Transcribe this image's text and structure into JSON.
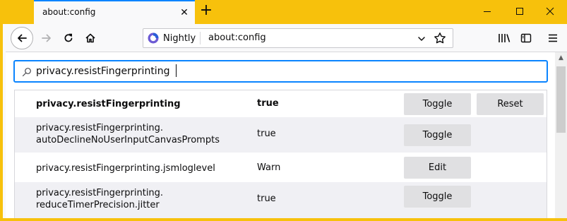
{
  "window": {
    "tab_title": "about:config",
    "tab_close": "✕",
    "new_tab": "+"
  },
  "toolbar": {
    "identity_label": "Nightly",
    "url": "about:config"
  },
  "search": {
    "value": "privacy.resistFingerprinting"
  },
  "prefs": [
    {
      "name_line1": "privacy.resistFingerprinting",
      "name_line2": "",
      "value": "true",
      "modified": true,
      "action": "Toggle",
      "reset": "Reset"
    },
    {
      "name_line1": "privacy.resistFingerprinting.",
      "name_line2": "autoDeclineNoUserInputCanvasPrompts",
      "value": "true",
      "modified": false,
      "action": "Toggle"
    },
    {
      "name_line1": "privacy.resistFingerprinting.jsmloglevel",
      "name_line2": "",
      "value": "Warn",
      "modified": false,
      "action": "Edit"
    },
    {
      "name_line1": "privacy.resistFingerprinting.",
      "name_line2": "reduceTimerPrecision.jitter",
      "value": "true",
      "modified": false,
      "action": "Toggle"
    }
  ],
  "colors": {
    "titlebar": "#f7c10c",
    "accent": "#0a84ff",
    "row_alt": "#f0f0f4",
    "button": "#e0e0e2"
  }
}
